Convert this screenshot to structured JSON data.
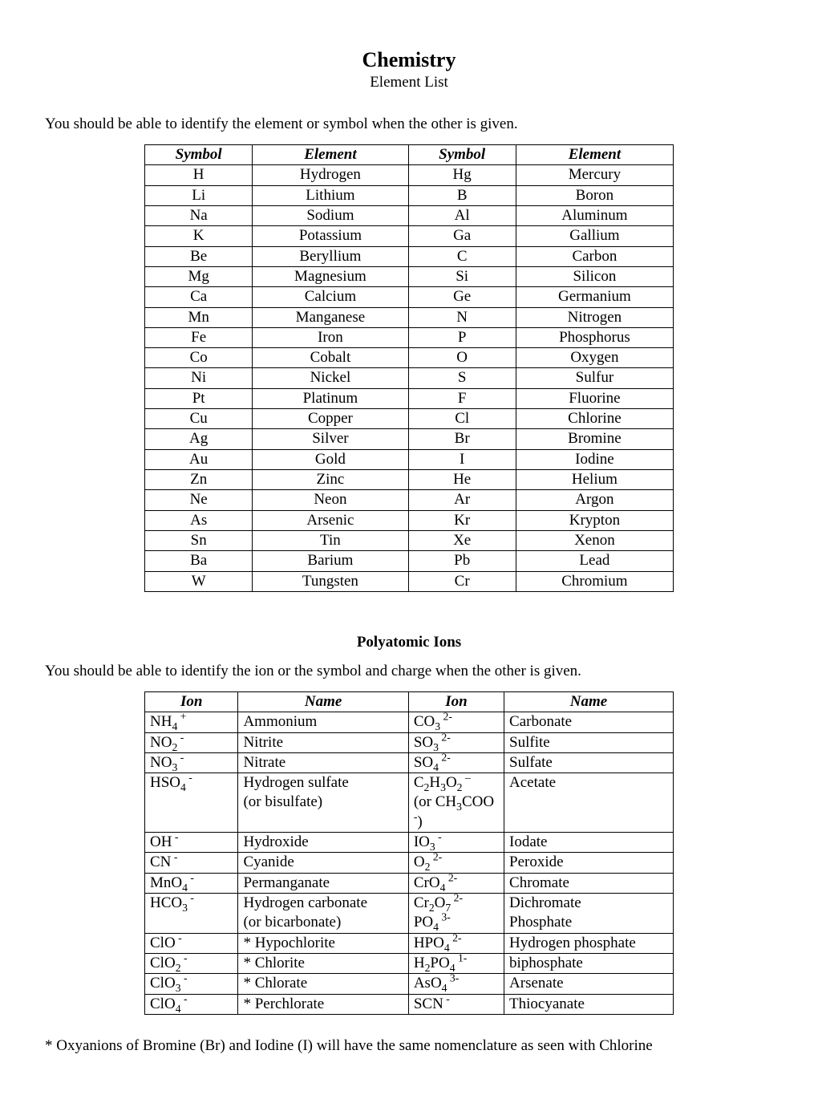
{
  "title": "Chemistry",
  "subtitle": "Element List",
  "intro1": "You should be able to identify the element or symbol when the other is given.",
  "elements_header": {
    "c1": "Symbol",
    "c2": "Element",
    "c3": "Symbol",
    "c4": "Element"
  },
  "elements": [
    {
      "s1": "H",
      "e1": "Hydrogen",
      "s2": "Hg",
      "e2": "Mercury"
    },
    {
      "s1": "Li",
      "e1": "Lithium",
      "s2": "B",
      "e2": "Boron"
    },
    {
      "s1": "Na",
      "e1": "Sodium",
      "s2": "Al",
      "e2": "Aluminum"
    },
    {
      "s1": "K",
      "e1": "Potassium",
      "s2": "Ga",
      "e2": "Gallium"
    },
    {
      "s1": "Be",
      "e1": "Beryllium",
      "s2": "C",
      "e2": "Carbon"
    },
    {
      "s1": "Mg",
      "e1": "Magnesium",
      "s2": "Si",
      "e2": "Silicon"
    },
    {
      "s1": "Ca",
      "e1": "Calcium",
      "s2": "Ge",
      "e2": "Germanium"
    },
    {
      "s1": "Mn",
      "e1": "Manganese",
      "s2": "N",
      "e2": "Nitrogen"
    },
    {
      "s1": "Fe",
      "e1": "Iron",
      "s2": "P",
      "e2": "Phosphorus"
    },
    {
      "s1": "Co",
      "e1": "Cobalt",
      "s2": "O",
      "e2": "Oxygen"
    },
    {
      "s1": "Ni",
      "e1": "Nickel",
      "s2": "S",
      "e2": "Sulfur"
    },
    {
      "s1": "Pt",
      "e1": "Platinum",
      "s2": "F",
      "e2": "Fluorine"
    },
    {
      "s1": "Cu",
      "e1": "Copper",
      "s2": "Cl",
      "e2": "Chlorine"
    },
    {
      "s1": "Ag",
      "e1": "Silver",
      "s2": "Br",
      "e2": "Bromine"
    },
    {
      "s1": "Au",
      "e1": "Gold",
      "s2": "I",
      "e2": "Iodine"
    },
    {
      "s1": "Zn",
      "e1": "Zinc",
      "s2": "He",
      "e2": "Helium"
    },
    {
      "s1": "Ne",
      "e1": "Neon",
      "s2": "Ar",
      "e2": "Argon"
    },
    {
      "s1": "As",
      "e1": "Arsenic",
      "s2": "Kr",
      "e2": "Krypton"
    },
    {
      "s1": "Sn",
      "e1": "Tin",
      "s2": "Xe",
      "e2": "Xenon"
    },
    {
      "s1": "Ba",
      "e1": "Barium",
      "s2": "Pb",
      "e2": "Lead"
    },
    {
      "s1": "W",
      "e1": "Tungsten",
      "s2": "Cr",
      "e2": "Chromium"
    }
  ],
  "ions_heading": "Polyatomic Ions",
  "intro2": "You should be able to identify the ion or the symbol and charge when the other is given.",
  "ions_header": {
    "c1": "Ion",
    "c2": "Name",
    "c3": "Ion",
    "c4": "Name"
  },
  "ions": [
    {
      "i1_base": "NH",
      "i1_sub": "4",
      "i1_sup": " +",
      "n1": "Ammonium",
      "i2_base": "CO",
      "i2_sub": "3",
      "i2_sup": " 2-",
      "n2": "Carbonate"
    },
    {
      "i1_base": "NO",
      "i1_sub": "2",
      "i1_sup": " -",
      "n1": "Nitrite",
      "i2_base": "SO",
      "i2_sub": "3",
      "i2_sup": " 2-",
      "n2": "Sulfite"
    },
    {
      "i1_base": "NO",
      "i1_sub": "3",
      "i1_sup": " -",
      "n1": "Nitrate",
      "i2_base": "SO",
      "i2_sub": "4",
      "i2_sup": " 2-",
      "n2": "Sulfate"
    },
    {
      "i1_base": "HSO",
      "i1_sub": "4",
      "i1_sup": " -",
      "n1": "Hydrogen sulfate",
      "n1b": "(or bisulfate)",
      "i2_base": "C",
      "i2_mid": "H",
      "i2_sub": "2",
      "i2_sub2": "3",
      "i2_base2": "O",
      "i2_sub3": "2",
      "i2_sup": " –",
      "i2_alt_pre": "(or CH",
      "i2_alt_sub": "3",
      "i2_alt_post": "COO",
      "i2_alt_sup": " -",
      "i2_alt_close": ")",
      "n2": "Acetate"
    },
    {
      "i1_base": "OH",
      "i1_sup": " -",
      "n1": "Hydroxide",
      "i2_base": "IO",
      "i2_sub": "3",
      "i2_sup": " -",
      "n2": "Iodate"
    },
    {
      "i1_base": "CN",
      "i1_sup": " -",
      "n1": "Cyanide",
      "i2_base": "O",
      "i2_sub": "2",
      "i2_sup": " 2-",
      "n2": "Peroxide"
    },
    {
      "i1_base": "MnO",
      "i1_sub": "4",
      "i1_sup": " -",
      "n1": "Permanganate",
      "i2_base": "CrO",
      "i2_sub": "4",
      "i2_sup": " 2-",
      "n2": "Chromate"
    },
    {
      "i1_base": "HCO",
      "i1_sub": "3",
      "i1_sup": " -",
      "n1": "Hydrogen carbonate",
      "n1b": "(or bicarbonate)",
      "i2a_base": "Cr",
      "i2a_sub": "2",
      "i2a_base2": "O",
      "i2a_sub2": "7",
      "i2a_sup": "  2-",
      "n2a": "Dichromate",
      "i2b_base": "PO",
      "i2b_sub": "4",
      "i2b_sup": " 3-",
      "n2b": "Phosphate"
    },
    {
      "i1_base": "ClO",
      "i1_sup": " -",
      "n1": "* Hypochlorite",
      "i2_base": "HPO",
      "i2_sub": "4",
      "i2_sup": " 2-",
      "n2": "Hydrogen phosphate"
    },
    {
      "i1_base": "ClO",
      "i1_sub": "2",
      "i1_sup": " -",
      "n1": "* Chlorite",
      "i2_base": "H",
      "i2_sub": "2",
      "i2_base2": "PO",
      "i2_sub2": "4",
      "i2_sup": " 1-",
      "n2": "biphosphate"
    },
    {
      "i1_base": "ClO",
      "i1_sub": "3",
      "i1_sup": " -",
      "n1": "* Chlorate",
      "i2_base": "AsO",
      "i2_sub": "4",
      "i2_sup": " 3-",
      "n2": "Arsenate"
    },
    {
      "i1_base": "ClO",
      "i1_sub": "4",
      "i1_sup": " -",
      "n1": "* Perchlorate",
      "i2_base": "SCN",
      "i2_sup": " -",
      "n2": "Thiocyanate"
    }
  ],
  "footnote": "* Oxyanions of Bromine (Br) and Iodine (I) will have the same nomenclature as seen with Chlorine"
}
